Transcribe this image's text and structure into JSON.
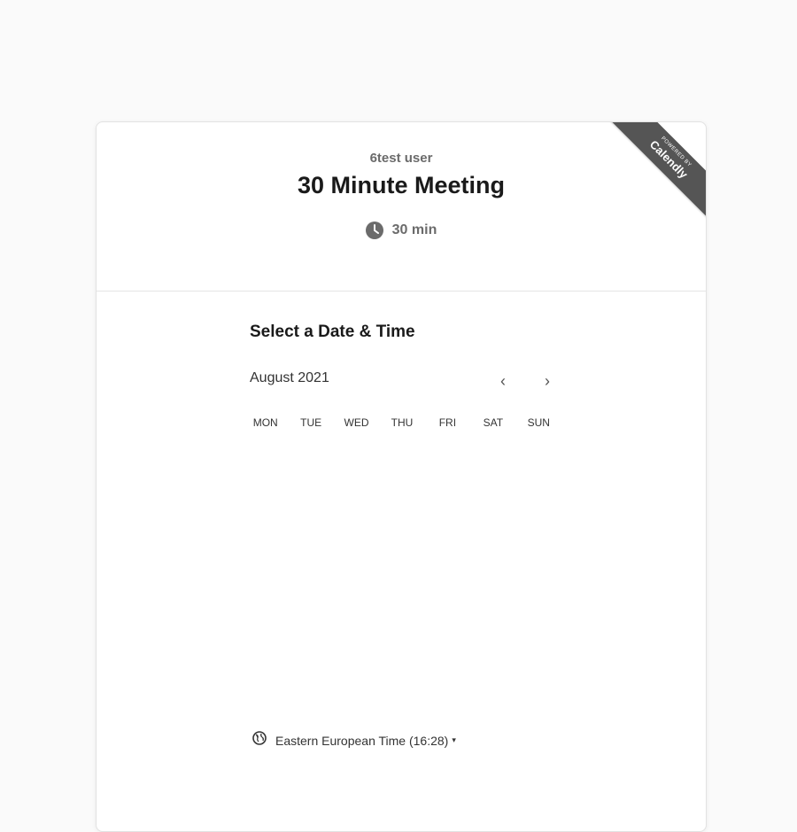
{
  "header": {
    "host_name": "6test user",
    "event_title": "30 Minute Meeting",
    "duration": "30 min",
    "ribbon": {
      "powered_by": "POWERED BY",
      "brand": "Calendly"
    }
  },
  "scheduler": {
    "section_title": "Select a Date & Time",
    "month_label": "August 2021",
    "prev_symbol": "‹",
    "next_symbol": "›",
    "weekdays": [
      "MON",
      "TUE",
      "WED",
      "THU",
      "FRI",
      "SAT",
      "SUN"
    ]
  },
  "timezone": {
    "label": "Eastern European Time (16:28)",
    "caret": "▾"
  },
  "icons": {
    "duration": "clock-icon",
    "timezone": "globe-icon",
    "prev": "chevron-left-icon",
    "next": "chevron-right-icon",
    "caret": "caret-down-icon"
  },
  "colors": {
    "ribbon": "#555555",
    "icon": "#6b6b6b",
    "title": "#1a1a1a"
  }
}
